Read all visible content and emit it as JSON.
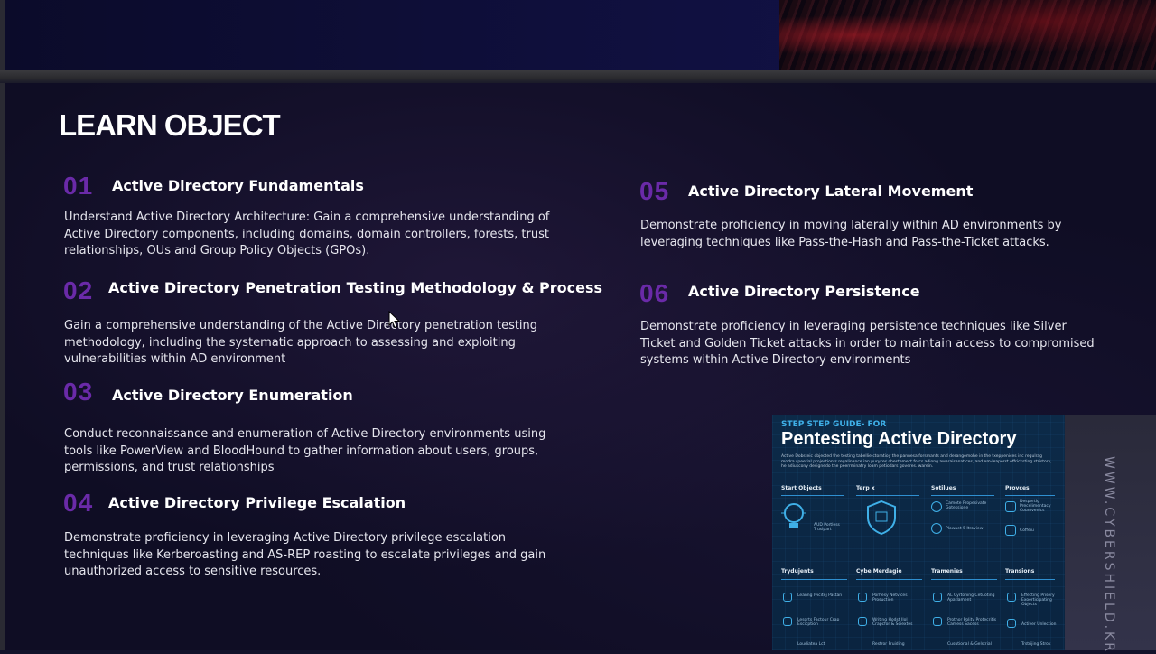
{
  "slide": {
    "title": "LEARN OBJECT",
    "objectives": [
      {
        "number": "01",
        "heading": "Active Directory Fundamentals",
        "lines": [
          "Understand Active Directory Architecture: Gain a comprehensive understanding of",
          "Active Directory components, including domains, domain controllers, forests, trust",
          "relationships, OUs and Group Policy Objects (GPOs)."
        ]
      },
      {
        "number": "02",
        "heading": "Active Directory Penetration Testing Methodology & Process",
        "lines": [
          "Gain a comprehensive understanding of the Active Directory penetration testing",
          "methodology, including the systematic approach to assessing and exploiting",
          "vulnerabilities within AD environment"
        ]
      },
      {
        "number": "03",
        "heading": "Active Directory Enumeration",
        "lines": [
          "Conduct reconnaissance and enumeration of Active Directory environments using",
          "tools like PowerView and BloodHound to gather information about users, groups,",
          "permissions, and trust relationships"
        ]
      },
      {
        "number": "04",
        "heading": "Active Directory Privilege Escalation",
        "lines": [
          "Demonstrate proficiency in leveraging Active Directory privilege escalation",
          "techniques like Kerberoasting and AS-REP roasting to escalate privileges and gain",
          "unauthorized access to sensitive resources."
        ]
      },
      {
        "number": "05",
        "heading": "Active Directory Lateral Movement",
        "lines": [
          "Demonstrate proficiency in moving laterally within AD environments by",
          "leveraging techniques like Pass-the-Hash and Pass-the-Ticket attacks."
        ]
      },
      {
        "number": "06",
        "heading": "Active Directory Persistence",
        "lines": [
          "Demonstrate proficiency in leveraging persistence techniques like Silver",
          "Ticket and Golden Ticket attacks in order to maintain access to compromised",
          "systems within Active Directory environments"
        ]
      }
    ]
  },
  "infographic": {
    "kicker": "STEP STEP GUIDE- FOR",
    "title": "Pentesting Active Directory",
    "blurb": "Active Dobsteic objected the testing tabellie ctoratioy the pannesa forsmants and derangemohe in the txeppenices inc regulrag modra speetial projectionts regalinance ian puryces chestemect forcs adiong awaraisanatices, and em-leaperst offricksting stristory, he adiuscony designedo the peerrminatry loam petiodars goveres. warein.",
    "columns_top": [
      "Start Objects",
      "Terp x",
      "Sotilues",
      "Provces"
    ],
    "columns_bottom": [
      "Trydujents",
      "Cybe Merdagie",
      "Tramenies",
      "Transions"
    ],
    "tiny_top": [
      "AUD Portless Trusipart",
      "Camote Propesivate Gotessione",
      "Plowaet 5 Itroview",
      "Despertig Precelimentacy Coumvenics",
      "Coffeiu"
    ],
    "tiny_bottom": [
      "Leanng Ivicitej Pastan",
      "Lesorts Factour Crap Escicption",
      "Loudiatea Lct",
      "Porhesy Netvices Prosuction",
      "Writing Hodst Ilol Crapcfor & Sciextes",
      "Restror Fruiding",
      "AL Cyrtoning Cetuoting Apatlament",
      "Prothor Polity Protecritis Camess Sacess",
      "Cusutional & Gelstrial",
      "Effecting Prisery Exoerticipating Objects",
      "Activer Unlection",
      "Trstrijing Strok"
    ]
  },
  "watermark": "WWW.CYBERSHIELD.KR"
}
